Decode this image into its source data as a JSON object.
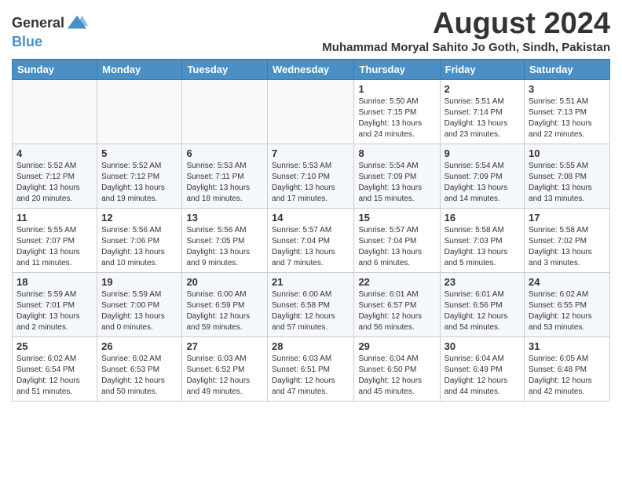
{
  "logo": {
    "line1": "General",
    "line2": "Blue"
  },
  "title": "August 2024",
  "location": "Muhammad Moryal Sahito Jo Goth, Sindh, Pakistan",
  "headers": [
    "Sunday",
    "Monday",
    "Tuesday",
    "Wednesday",
    "Thursday",
    "Friday",
    "Saturday"
  ],
  "weeks": [
    [
      {
        "day": "",
        "info": ""
      },
      {
        "day": "",
        "info": ""
      },
      {
        "day": "",
        "info": ""
      },
      {
        "day": "",
        "info": ""
      },
      {
        "day": "1",
        "info": "Sunrise: 5:50 AM\nSunset: 7:15 PM\nDaylight: 13 hours\nand 24 minutes."
      },
      {
        "day": "2",
        "info": "Sunrise: 5:51 AM\nSunset: 7:14 PM\nDaylight: 13 hours\nand 23 minutes."
      },
      {
        "day": "3",
        "info": "Sunrise: 5:51 AM\nSunset: 7:13 PM\nDaylight: 13 hours\nand 22 minutes."
      }
    ],
    [
      {
        "day": "4",
        "info": "Sunrise: 5:52 AM\nSunset: 7:12 PM\nDaylight: 13 hours\nand 20 minutes."
      },
      {
        "day": "5",
        "info": "Sunrise: 5:52 AM\nSunset: 7:12 PM\nDaylight: 13 hours\nand 19 minutes."
      },
      {
        "day": "6",
        "info": "Sunrise: 5:53 AM\nSunset: 7:11 PM\nDaylight: 13 hours\nand 18 minutes."
      },
      {
        "day": "7",
        "info": "Sunrise: 5:53 AM\nSunset: 7:10 PM\nDaylight: 13 hours\nand 17 minutes."
      },
      {
        "day": "8",
        "info": "Sunrise: 5:54 AM\nSunset: 7:09 PM\nDaylight: 13 hours\nand 15 minutes."
      },
      {
        "day": "9",
        "info": "Sunrise: 5:54 AM\nSunset: 7:09 PM\nDaylight: 13 hours\nand 14 minutes."
      },
      {
        "day": "10",
        "info": "Sunrise: 5:55 AM\nSunset: 7:08 PM\nDaylight: 13 hours\nand 13 minutes."
      }
    ],
    [
      {
        "day": "11",
        "info": "Sunrise: 5:55 AM\nSunset: 7:07 PM\nDaylight: 13 hours\nand 11 minutes."
      },
      {
        "day": "12",
        "info": "Sunrise: 5:56 AM\nSunset: 7:06 PM\nDaylight: 13 hours\nand 10 minutes."
      },
      {
        "day": "13",
        "info": "Sunrise: 5:56 AM\nSunset: 7:05 PM\nDaylight: 13 hours\nand 9 minutes."
      },
      {
        "day": "14",
        "info": "Sunrise: 5:57 AM\nSunset: 7:04 PM\nDaylight: 13 hours\nand 7 minutes."
      },
      {
        "day": "15",
        "info": "Sunrise: 5:57 AM\nSunset: 7:04 PM\nDaylight: 13 hours\nand 6 minutes."
      },
      {
        "day": "16",
        "info": "Sunrise: 5:58 AM\nSunset: 7:03 PM\nDaylight: 13 hours\nand 5 minutes."
      },
      {
        "day": "17",
        "info": "Sunrise: 5:58 AM\nSunset: 7:02 PM\nDaylight: 13 hours\nand 3 minutes."
      }
    ],
    [
      {
        "day": "18",
        "info": "Sunrise: 5:59 AM\nSunset: 7:01 PM\nDaylight: 13 hours\nand 2 minutes."
      },
      {
        "day": "19",
        "info": "Sunrise: 5:59 AM\nSunset: 7:00 PM\nDaylight: 13 hours\nand 0 minutes."
      },
      {
        "day": "20",
        "info": "Sunrise: 6:00 AM\nSunset: 6:59 PM\nDaylight: 12 hours\nand 59 minutes."
      },
      {
        "day": "21",
        "info": "Sunrise: 6:00 AM\nSunset: 6:58 PM\nDaylight: 12 hours\nand 57 minutes."
      },
      {
        "day": "22",
        "info": "Sunrise: 6:01 AM\nSunset: 6:57 PM\nDaylight: 12 hours\nand 56 minutes."
      },
      {
        "day": "23",
        "info": "Sunrise: 6:01 AM\nSunset: 6:56 PM\nDaylight: 12 hours\nand 54 minutes."
      },
      {
        "day": "24",
        "info": "Sunrise: 6:02 AM\nSunset: 6:55 PM\nDaylight: 12 hours\nand 53 minutes."
      }
    ],
    [
      {
        "day": "25",
        "info": "Sunrise: 6:02 AM\nSunset: 6:54 PM\nDaylight: 12 hours\nand 51 minutes."
      },
      {
        "day": "26",
        "info": "Sunrise: 6:02 AM\nSunset: 6:53 PM\nDaylight: 12 hours\nand 50 minutes."
      },
      {
        "day": "27",
        "info": "Sunrise: 6:03 AM\nSunset: 6:52 PM\nDaylight: 12 hours\nand 49 minutes."
      },
      {
        "day": "28",
        "info": "Sunrise: 6:03 AM\nSunset: 6:51 PM\nDaylight: 12 hours\nand 47 minutes."
      },
      {
        "day": "29",
        "info": "Sunrise: 6:04 AM\nSunset: 6:50 PM\nDaylight: 12 hours\nand 45 minutes."
      },
      {
        "day": "30",
        "info": "Sunrise: 6:04 AM\nSunset: 6:49 PM\nDaylight: 12 hours\nand 44 minutes."
      },
      {
        "day": "31",
        "info": "Sunrise: 6:05 AM\nSunset: 6:48 PM\nDaylight: 12 hours\nand 42 minutes."
      }
    ]
  ]
}
